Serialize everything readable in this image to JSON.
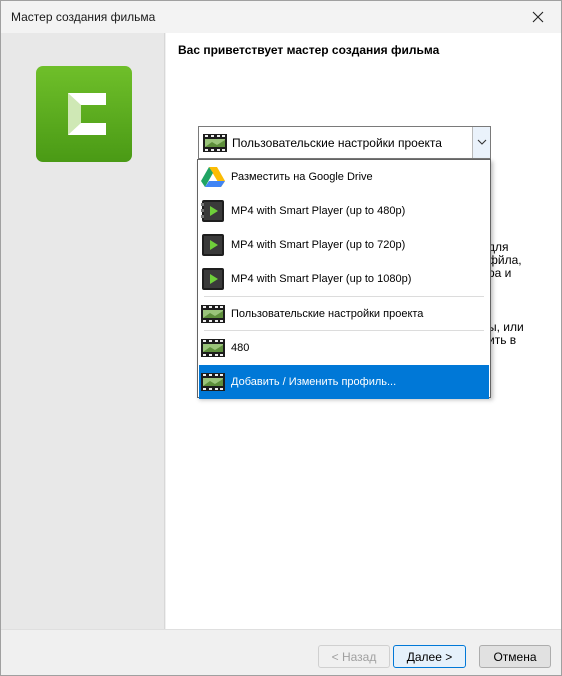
{
  "window": {
    "title": "Мастер создания фильма"
  },
  "content": {
    "heading": "Вас приветствует мастер создания фильма",
    "obscured_text_a": [
      "для",
      "фйла,",
      "ра и"
    ],
    "obscured_text_b": [
      "ы, или",
      "ить в"
    ]
  },
  "combo": {
    "selected": "Пользовательские настройки проекта",
    "selected_icon": "film-strip-icon"
  },
  "dropdown": {
    "items": [
      {
        "label": "Разместить на Google Drive",
        "icon": "google-drive-icon"
      },
      {
        "label": "MP4 with Smart Player (up to 480p)",
        "icon": "smart-player-icon"
      },
      {
        "label": "MP4 with Smart Player (up to 720p)",
        "icon": "smart-player-icon"
      },
      {
        "label": "MP4 with Smart Player (up to 1080p)",
        "icon": "smart-player-icon"
      },
      {
        "label": "Пользовательские настройки проекта",
        "icon": "film-strip-icon"
      },
      {
        "label": "480",
        "icon": "film-strip-icon"
      },
      {
        "label": "Добавить / Изменить профиль...",
        "icon": "film-strip-icon",
        "highlighted": true
      }
    ]
  },
  "footer": {
    "back_label": "< Назад",
    "next_label": "Далее >",
    "cancel_label": "Отмена"
  },
  "colors": {
    "accent": "#0078d7",
    "logo_green": "#5aa81e"
  }
}
